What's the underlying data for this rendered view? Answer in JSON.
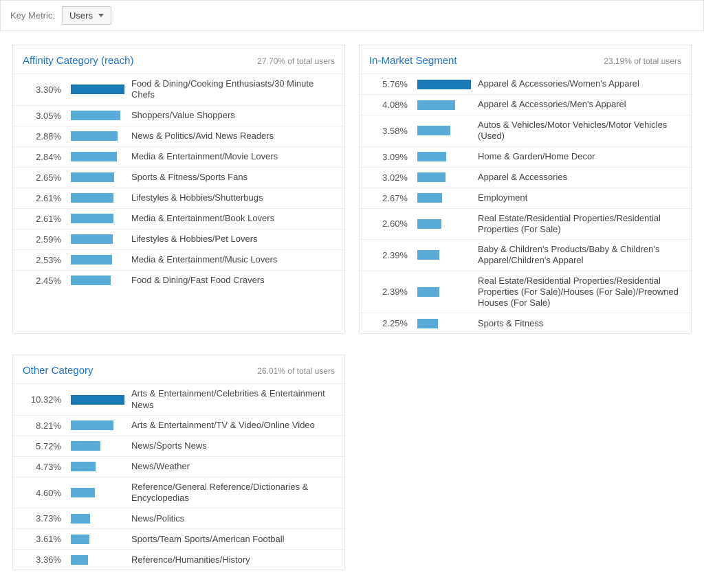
{
  "key_metric_label": "Key Metric:",
  "key_metric_value": "Users",
  "panels": {
    "affinity": {
      "title": "Affinity Category (reach)",
      "subtitle": "27.70% of total users",
      "max": 3.3,
      "rows": [
        {
          "pct": "3.30%",
          "v": 3.3,
          "label": "Food & Dining/Cooking Enthusiasts/30 Minute Chefs",
          "dark": true
        },
        {
          "pct": "3.05%",
          "v": 3.05,
          "label": "Shoppers/Value Shoppers"
        },
        {
          "pct": "2.88%",
          "v": 2.88,
          "label": "News & Politics/Avid News Readers"
        },
        {
          "pct": "2.84%",
          "v": 2.84,
          "label": "Media & Entertainment/Movie Lovers"
        },
        {
          "pct": "2.65%",
          "v": 2.65,
          "label": "Sports & Fitness/Sports Fans"
        },
        {
          "pct": "2.61%",
          "v": 2.61,
          "label": "Lifestyles & Hobbies/Shutterbugs"
        },
        {
          "pct": "2.61%",
          "v": 2.61,
          "label": "Media & Entertainment/Book Lovers"
        },
        {
          "pct": "2.59%",
          "v": 2.59,
          "label": "Lifestyles & Hobbies/Pet Lovers"
        },
        {
          "pct": "2.53%",
          "v": 2.53,
          "label": "Media & Entertainment/Music Lovers"
        },
        {
          "pct": "2.45%",
          "v": 2.45,
          "label": "Food & Dining/Fast Food Cravers"
        }
      ]
    },
    "inmarket": {
      "title": "In-Market Segment",
      "subtitle": "23.19% of total users",
      "max": 5.76,
      "rows": [
        {
          "pct": "5.76%",
          "v": 5.76,
          "label": "Apparel & Accessories/Women's Apparel",
          "dark": true
        },
        {
          "pct": "4.08%",
          "v": 4.08,
          "label": "Apparel & Accessories/Men's Apparel"
        },
        {
          "pct": "3.58%",
          "v": 3.58,
          "label": "Autos & Vehicles/Motor Vehicles/Motor Vehicles (Used)"
        },
        {
          "pct": "3.09%",
          "v": 3.09,
          "label": "Home & Garden/Home Decor"
        },
        {
          "pct": "3.02%",
          "v": 3.02,
          "label": "Apparel & Accessories"
        },
        {
          "pct": "2.67%",
          "v": 2.67,
          "label": "Employment"
        },
        {
          "pct": "2.60%",
          "v": 2.6,
          "label": "Real Estate/Residential Properties/Residential Properties (For Sale)"
        },
        {
          "pct": "2.39%",
          "v": 2.39,
          "label": "Baby & Children's Products/Baby & Children's Apparel/Children's Apparel"
        },
        {
          "pct": "2.39%",
          "v": 2.39,
          "label": "Real Estate/Residential Properties/Residential Properties (For Sale)/Houses (For Sale)/Preowned Houses (For Sale)"
        },
        {
          "pct": "2.25%",
          "v": 2.25,
          "label": "Sports & Fitness"
        }
      ]
    },
    "other": {
      "title": "Other Category",
      "subtitle": "26.01% of total users",
      "max": 10.32,
      "rows": [
        {
          "pct": "10.32%",
          "v": 10.32,
          "label": "Arts & Entertainment/Celebrities & Entertainment News",
          "dark": true
        },
        {
          "pct": "8.21%",
          "v": 8.21,
          "label": "Arts & Entertainment/TV & Video/Online Video"
        },
        {
          "pct": "5.72%",
          "v": 5.72,
          "label": "News/Sports News"
        },
        {
          "pct": "4.73%",
          "v": 4.73,
          "label": "News/Weather"
        },
        {
          "pct": "4.60%",
          "v": 4.6,
          "label": "Reference/General Reference/Dictionaries & Encyclopedias"
        },
        {
          "pct": "3.73%",
          "v": 3.73,
          "label": "News/Politics"
        },
        {
          "pct": "3.61%",
          "v": 3.61,
          "label": "Sports/Team Sports/American Football"
        },
        {
          "pct": "3.36%",
          "v": 3.36,
          "label": "Reference/Humanities/History"
        }
      ]
    }
  },
  "chart_data": [
    {
      "type": "bar",
      "title": "Affinity Category (reach)",
      "subtitle": "27.70% of total users",
      "xlabel": "",
      "ylabel": "",
      "categories": [
        "Food & Dining/Cooking Enthusiasts/30 Minute Chefs",
        "Shoppers/Value Shoppers",
        "News & Politics/Avid News Readers",
        "Media & Entertainment/Movie Lovers",
        "Sports & Fitness/Sports Fans",
        "Lifestyles & Hobbies/Shutterbugs",
        "Media & Entertainment/Book Lovers",
        "Lifestyles & Hobbies/Pet Lovers",
        "Media & Entertainment/Music Lovers",
        "Food & Dining/Fast Food Cravers"
      ],
      "values": [
        3.3,
        3.05,
        2.88,
        2.84,
        2.65,
        2.61,
        2.61,
        2.59,
        2.53,
        2.45
      ]
    },
    {
      "type": "bar",
      "title": "In-Market Segment",
      "subtitle": "23.19% of total users",
      "xlabel": "",
      "ylabel": "",
      "categories": [
        "Apparel & Accessories/Women's Apparel",
        "Apparel & Accessories/Men's Apparel",
        "Autos & Vehicles/Motor Vehicles/Motor Vehicles (Used)",
        "Home & Garden/Home Decor",
        "Apparel & Accessories",
        "Employment",
        "Real Estate/Residential Properties/Residential Properties (For Sale)",
        "Baby & Children's Products/Baby & Children's Apparel/Children's Apparel",
        "Real Estate/Residential Properties/Residential Properties (For Sale)/Houses (For Sale)/Preowned Houses (For Sale)",
        "Sports & Fitness"
      ],
      "values": [
        5.76,
        4.08,
        3.58,
        3.09,
        3.02,
        2.67,
        2.6,
        2.39,
        2.39,
        2.25
      ]
    },
    {
      "type": "bar",
      "title": "Other Category",
      "subtitle": "26.01% of total users",
      "xlabel": "",
      "ylabel": "",
      "categories": [
        "Arts & Entertainment/Celebrities & Entertainment News",
        "Arts & Entertainment/TV & Video/Online Video",
        "News/Sports News",
        "News/Weather",
        "Reference/General Reference/Dictionaries & Encyclopedias",
        "News/Politics",
        "Sports/Team Sports/American Football",
        "Reference/Humanities/History"
      ],
      "values": [
        10.32,
        8.21,
        5.72,
        4.73,
        4.6,
        3.73,
        3.61,
        3.36
      ]
    }
  ]
}
